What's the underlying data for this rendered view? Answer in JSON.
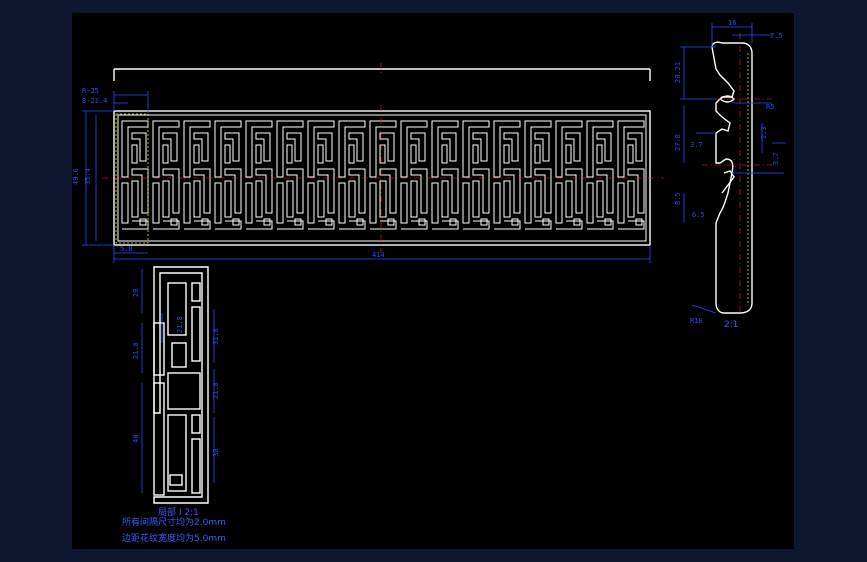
{
  "canvas": {
    "frame_color": "#0F1730",
    "paper_color": "#000000",
    "line_color": "#FFFFFF",
    "dimension_color": "#2A4AFF",
    "centerline_color": "#FF2020",
    "highlight_color": "#E8E000"
  },
  "dimensions": {
    "top_width": "R-25",
    "top_offset": "8-21.4",
    "height_a": "49.6",
    "height_b": "35.4",
    "bottom_left": "5.8",
    "bottom_total": "414",
    "detail_d1": "20",
    "detail_d2": "21.8",
    "detail_d3": "31.8",
    "detail_d4": "40",
    "detail_d5": "21.8",
    "detail_d6": "21.8",
    "detail_d7": "30",
    "side_top": "16",
    "side_top2": "7.5",
    "side_a": "20.21",
    "side_b": "R5",
    "side_c": "27.8",
    "side_d": "3.7",
    "side_e": "2.3",
    "side_f": "8.5",
    "side_g": "6.5",
    "side_r": "R10"
  },
  "detail_label": "局部 I 2:1",
  "side_label": "2:1",
  "notes": [
    "所有间隔尺寸均为2.0mm",
    "边距花纹宽度均为5.0mm"
  ]
}
